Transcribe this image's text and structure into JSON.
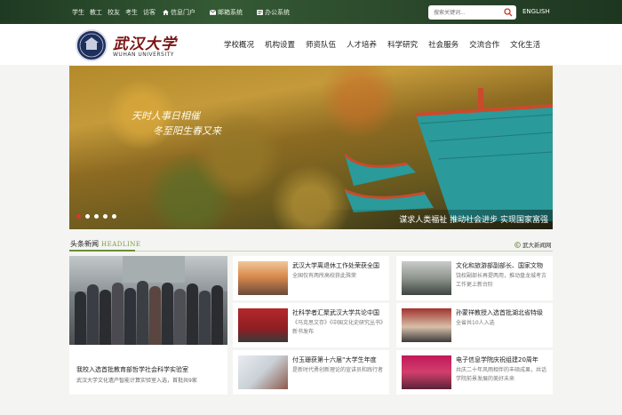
{
  "topbar": {
    "links": [
      "学生",
      "教工",
      "校友",
      "考生",
      "访客"
    ],
    "sys": [
      {
        "label": "信息门户",
        "icon": "home-icon"
      },
      {
        "label": "邮箱系统",
        "icon": "mail-icon"
      },
      {
        "label": "办公系统",
        "icon": "office-icon"
      }
    ],
    "search_placeholder": "搜索关键词...",
    "english": "ENGLISH"
  },
  "header": {
    "logo_cn": "武汉大学",
    "logo_en": "WUHAN UNIVERSITY",
    "nav": [
      "学校概况",
      "机构设置",
      "师资队伍",
      "人才培养",
      "科学研究",
      "社会服务",
      "交流合作",
      "文化生活"
    ]
  },
  "banner": {
    "calligraphy_1": "天时人事日相催",
    "calligraphy_2": "冬至阳生春又来",
    "slogan": "谋求人类福祉 推动社会进步 实现国家富强",
    "dots_count": 5,
    "active_dot": 0,
    "colors": {
      "roof": "#2a9a9a",
      "eave": "#c94b2c"
    }
  },
  "news": {
    "title": "头条新闻",
    "title_en": "HEADLINE",
    "more": "武大新闻网",
    "feature": {
      "title": "我校入选首批教育部哲学社会科学实验室",
      "desc": "武汉大学文化遗产智能计算实验室入选，首批共9家"
    },
    "col2": [
      {
        "title": "武汉大学离退休工作处荣获全国",
        "desc": "全国仅有两所高校获此殊荣"
      },
      {
        "title": "社科学者汇聚武汉大学共论中国",
        "desc": "《马克思文存》《中国文化史研究丛书》新书发布"
      },
      {
        "title": "付玉珊获第十六届“大学生年度",
        "desc": "是新时代勇创新理论的宣讲员和践行者"
      }
    ],
    "col3": [
      {
        "title": "文化和旅游部副部长、国家文物",
        "desc": "饶权副部长再提两用，推动盘龙城考古工作更上新台阶"
      },
      {
        "title": "孙蒙祥教授入选首批湖北省特级",
        "desc": "全省共10人入选"
      },
      {
        "title": "电子信息学院庆祝组建20周年",
        "desc": "共庆二十年风雨相伴的丰硕成果，共话学院前景发展的美好未来"
      }
    ]
  }
}
